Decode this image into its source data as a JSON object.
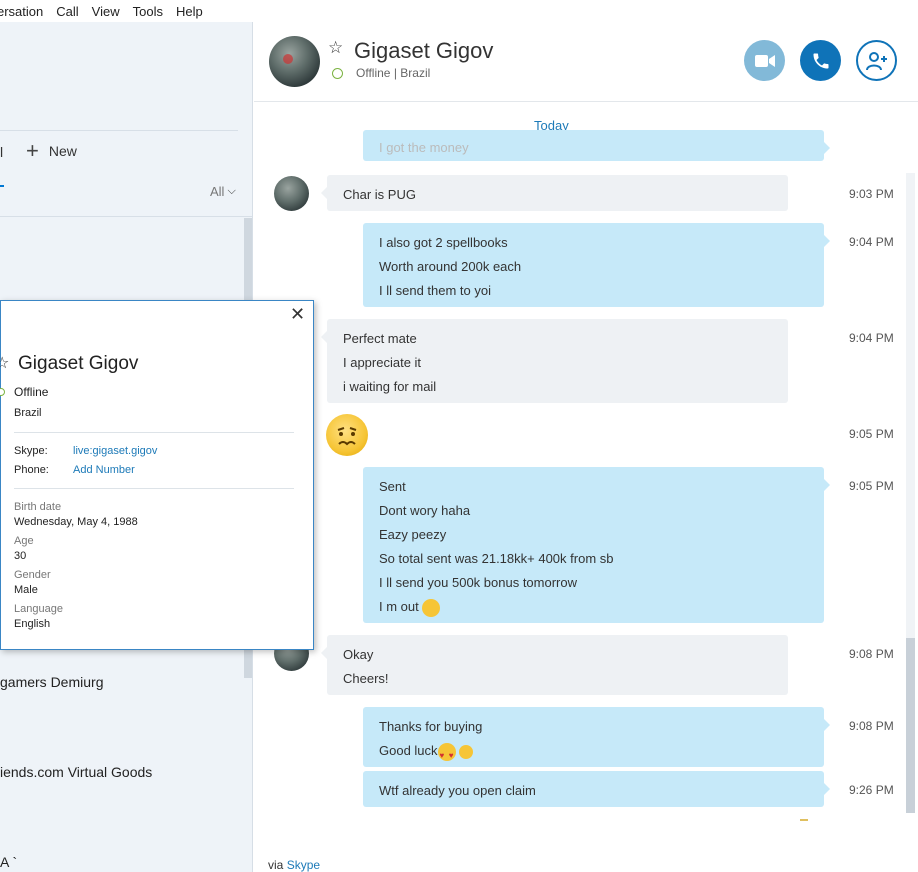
{
  "menubar": {
    "items": [
      "ersation",
      "Call",
      "View",
      "Tools",
      "Help"
    ]
  },
  "sidebar": {
    "call_label": "l",
    "new_label": "New",
    "filter_label": "All",
    "items": [
      "gamers Demiurg",
      "iends.com Virtual Goods",
      "A `"
    ]
  },
  "header": {
    "name": "Gigaset Gigov",
    "status": "Offline",
    "location": "Brazil",
    "separator": "|"
  },
  "conversation": {
    "day_label": "Today",
    "partial_message": "I got the money",
    "messages": [
      {
        "dir": "in",
        "lines": [
          "Char is PUG"
        ],
        "time": "9:03 PM"
      },
      {
        "dir": "out",
        "lines": [
          "I also got 2  spellbooks",
          "Worth around 200k each",
          "I ll send them to yoi"
        ],
        "time": "9:04 PM"
      },
      {
        "dir": "in",
        "lines": [
          "Perfect mate",
          "I appreciate it",
          "i waiting for mail"
        ],
        "time": "9:04 PM"
      },
      {
        "dir": "in",
        "lines": [],
        "emoji": "worried-face-emoji",
        "time": "9:05 PM"
      },
      {
        "dir": "out",
        "lines": [
          "Sent",
          "Dont wory haha",
          "Eazy peezy",
          "So total sent was 21.18kk+ 400k from sb",
          "I ll send you 500k bonus tomorrow",
          "I m out"
        ],
        "time": "9:05 PM"
      },
      {
        "dir": "in",
        "lines": [
          "Okay",
          "Cheers!"
        ],
        "time": "9:08 PM"
      },
      {
        "dir": "out",
        "lines": [
          "Thanks for buying",
          "Good luck"
        ],
        "time": "9:08 PM"
      },
      {
        "dir": "out",
        "lines": [
          "Wtf already you open claim"
        ],
        "time": "9:26 PM"
      }
    ],
    "via_prefix": "via",
    "via_link": "Skype"
  },
  "profile_card": {
    "name": "Gigaset Gigov",
    "status": "Offline",
    "country": "Brazil",
    "skype_label": "Skype:",
    "skype_value": "live:gigaset.gigov",
    "phone_label": "Phone:",
    "phone_value": "Add Number",
    "birth_label": "Birth date",
    "birth_value": "Wednesday, May 4, 1988",
    "age_label": "Age",
    "age_value": "30",
    "gender_label": "Gender",
    "gender_value": "Male",
    "language_label": "Language",
    "language_value": "English"
  },
  "colors": {
    "accent": "#0f73b8",
    "outgoing_bubble": "#c6e9f9",
    "incoming_bubble": "#eef1f4",
    "link": "#1d7ab8",
    "status_ring": "#7cb342"
  }
}
